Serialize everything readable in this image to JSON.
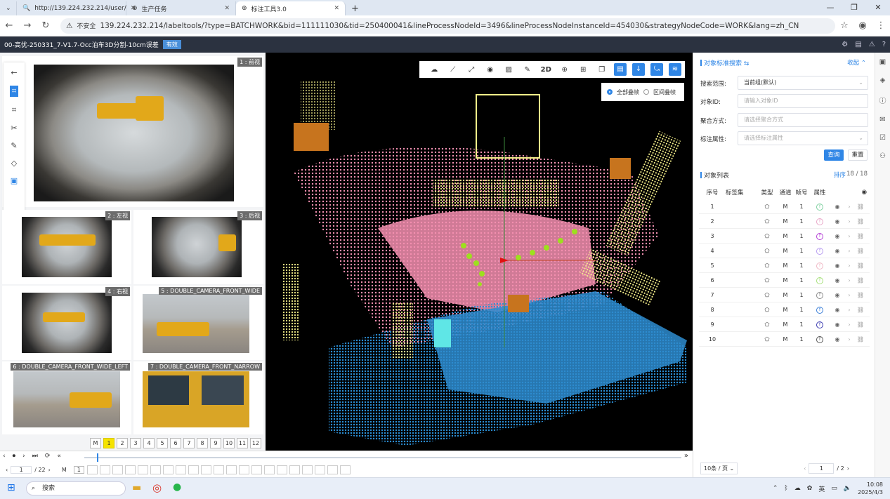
{
  "browser": {
    "tabs": [
      {
        "title": "http://139.224.232.214/user/",
        "icon": "search-icon"
      },
      {
        "title": "生产任务",
        "icon": "globe-icon"
      },
      {
        "title": "标注工具3.0",
        "icon": "globe-icon"
      }
    ],
    "secure_label": "不安全",
    "url": "139.224.232.214/labeltools/?type=BATCHWORK&bid=111111030&tid=250400041&lineProcessNodeId=3496&lineProcessNodeInstanceId=454030&strategyNodeCode=WORK&lang=zh_CN"
  },
  "app": {
    "task_title": "00-高优-250331_7-V1.7-Occ泊车3D分割-10cm误差",
    "status_badge": "有效"
  },
  "cameras": [
    {
      "label": "1 : 前视"
    },
    {
      "label": "2 : 左视"
    },
    {
      "label": "3 : 后视"
    },
    {
      "label": "4 : 右视"
    },
    {
      "label": "5 : DOUBLE_CAMERA_FRONT_WIDE"
    },
    {
      "label": "6 : DOUBLE_CAMERA_FRONT_WIDE_LEFT"
    },
    {
      "label": "7 : DOUBLE_CAMERA_FRONT_NARROW"
    }
  ],
  "camera_pages": {
    "mode": "M",
    "pages": [
      "1",
      "2",
      "3",
      "4",
      "5",
      "6",
      "7",
      "8",
      "9",
      "10",
      "11",
      "12"
    ]
  },
  "toolbar3d": {
    "label_2d": "2D"
  },
  "frame_mode": {
    "all": "全部叠帧",
    "range": "区间叠帧"
  },
  "search_panel": {
    "title": "对象标准搜索",
    "collapse": "收起",
    "scope_label": "搜索范围:",
    "scope_value": "当前组(默认)",
    "id_label": "对象ID:",
    "id_placeholder": "请输入对象ID",
    "agg_label": "聚合方式:",
    "agg_placeholder": "请选择聚合方式",
    "attr_label": "标注属性:",
    "attr_placeholder": "请选择标注属性",
    "query": "查询",
    "reset": "重置"
  },
  "object_list": {
    "title": "对象列表",
    "sort": "排序",
    "count": "18 / 18",
    "headers": [
      "序号",
      "标签集",
      "类型",
      "通道",
      "帧号",
      "属性"
    ],
    "rows": [
      {
        "no": "1",
        "channel": "M",
        "frame": "1",
        "attr": "f",
        "color": "#7fd0a0"
      },
      {
        "no": "2",
        "channel": "M",
        "frame": "1",
        "attr": "f",
        "color": "#e9a7c8"
      },
      {
        "no": "3",
        "channel": "M",
        "frame": "1",
        "attr": "f",
        "color": "#b43fd6"
      },
      {
        "no": "4",
        "channel": "M",
        "frame": "1",
        "attr": "f",
        "color": "#b79cf0"
      },
      {
        "no": "5",
        "channel": "M",
        "frame": "1",
        "attr": "f",
        "color": "#f0b9c6"
      },
      {
        "no": "6",
        "channel": "M",
        "frame": "1",
        "attr": "f",
        "color": "#a6e07a"
      },
      {
        "no": "7",
        "channel": "M",
        "frame": "1",
        "attr": "f",
        "color": "#8a8a8a"
      },
      {
        "no": "8",
        "channel": "M",
        "frame": "1",
        "attr": "f",
        "color": "#3b7fd8"
      },
      {
        "no": "9",
        "channel": "M",
        "frame": "1",
        "attr": "f",
        "color": "#3a3ab0"
      },
      {
        "no": "10",
        "channel": "M",
        "frame": "1",
        "attr": "f",
        "color": "#555555"
      }
    ]
  },
  "pager": {
    "size": "10条 / 页",
    "current": "1",
    "total": "/ 2"
  },
  "timeline": {
    "frame": "1",
    "total": "/ 22",
    "mode": "M",
    "slot": "1"
  },
  "taskbar": {
    "search": "搜索",
    "ime": "英",
    "time": "10:08",
    "date": "2025/4/3"
  }
}
